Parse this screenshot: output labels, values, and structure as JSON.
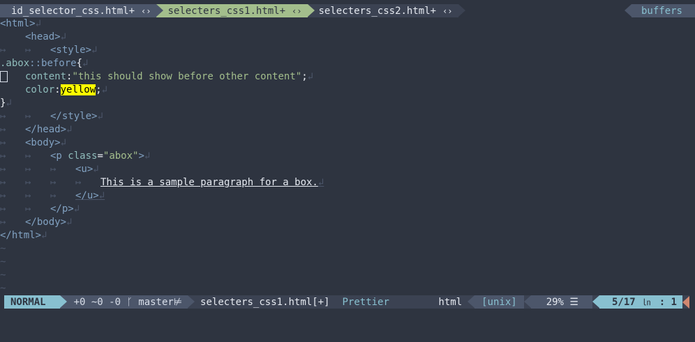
{
  "tabs": [
    {
      "label": "id_selector_css.html+",
      "mod": "‹›"
    },
    {
      "label": "selecters_css1.html+",
      "mod": "‹›"
    },
    {
      "label": "selecters_css2.html+",
      "mod": "‹›"
    }
  ],
  "buffers_label": "buffers",
  "code": {
    "l1": "<html>",
    "l2": "<head>",
    "l3": "<style>",
    "l4_sel": ".abox",
    "l4_pseudo": "::before",
    "l4_brace": "{",
    "l5_prop": "content",
    "l5_val": "\"this should show before other content\"",
    "l5_end": ";",
    "l6_prop": "color",
    "l6_val": "yellow",
    "l6_end": ";",
    "l7": "}",
    "l8": "</style>",
    "l9": "</head>",
    "l10": "<body>",
    "l11_open": "<p",
    "l11_attr": "class",
    "l11_val": "\"abox\"",
    "l11_close": ">",
    "l12": "<u>",
    "l13": "This is a sample paragraph for a box.",
    "l14": "</u>",
    "l15": "</p>",
    "l16": "</body>",
    "l17": "</html>"
  },
  "glyphs": {
    "tab": "↦",
    "eol": "↲",
    "tilde": "~"
  },
  "status": {
    "mode": "NORMAL",
    "git": "+0 ~0 -0 ᚴ master",
    "git_flag": "⊭",
    "filename": "selecters_css1.html[+]",
    "linter": "Prettier",
    "filetype": "html",
    "fileformat": "[unix]",
    "percent": "29% ☰",
    "position": "5/17",
    "ln_glyph": "㏑",
    "column": ":  1"
  },
  "colors": {
    "background": "#2e3440",
    "accent": "#88c0d0",
    "active_tab": "#a3be8c",
    "highlight": "#ffff00"
  }
}
